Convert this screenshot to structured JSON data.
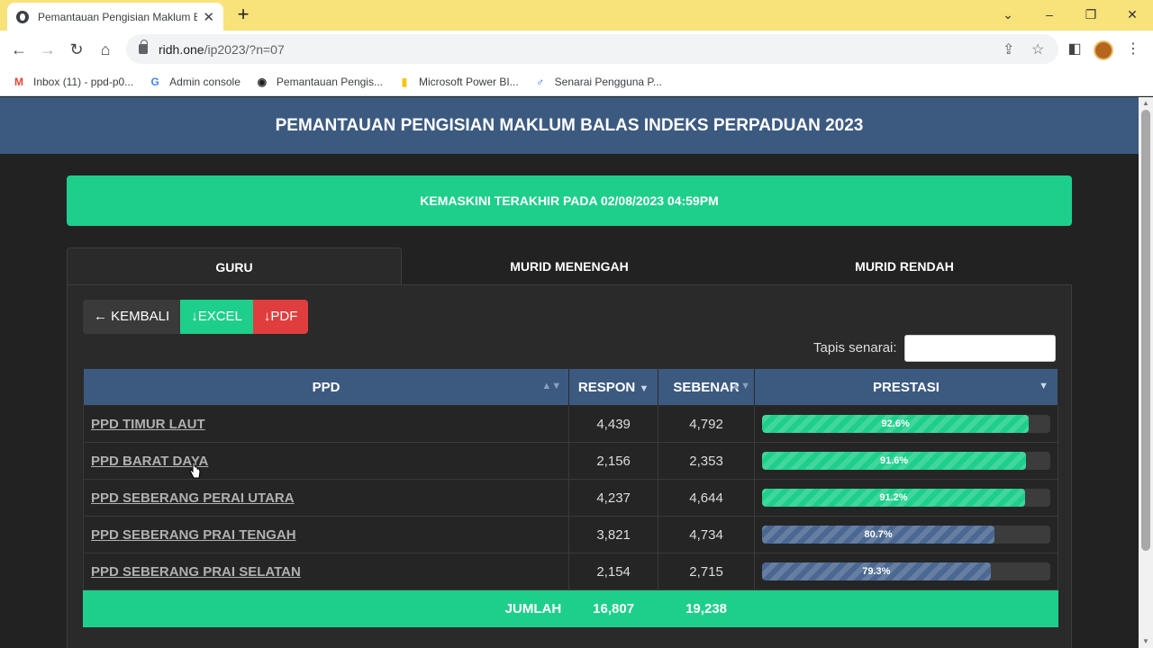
{
  "browser": {
    "tab_title": "Pemantauan Pengisian Maklum B",
    "url_host": "ridh.one",
    "url_path": "/ip2023/?n=07",
    "bookmarks": [
      {
        "icon": "gmail-icon",
        "glyph": "M",
        "color": "#ea4335",
        "label": "Inbox (11) - ppd-p0..."
      },
      {
        "icon": "google-icon",
        "glyph": "G",
        "color": "#4285f4",
        "label": "Admin console"
      },
      {
        "icon": "globe-icon",
        "glyph": "◉",
        "color": "#202124",
        "label": "Pemantauan Pengis..."
      },
      {
        "icon": "powerbi-icon",
        "glyph": "▮",
        "color": "#f2c811",
        "label": "Microsoft Power BI..."
      },
      {
        "icon": "user-list-icon",
        "glyph": "♂",
        "color": "#1a73e8",
        "label": "Senarai Pengguna P..."
      }
    ]
  },
  "page": {
    "title": "PEMANTAUAN PENGISIAN MAKLUM BALAS INDEKS PERPADUAN 2023",
    "updated": "KEMASKINI TERAKHIR PADA 02/08/2023 04:59PM",
    "tabs": [
      "GURU",
      "MURID MENENGAH",
      "MURID RENDAH"
    ],
    "buttons": {
      "back": "← KEMBALI",
      "excel": "↓EXCEL",
      "pdf": "↓PDF"
    },
    "filter_label": "Tapis senarai:",
    "filter_value": ""
  },
  "table": {
    "headers": [
      "PPD",
      "RESPON",
      "SEBENAR",
      "PRESTASI"
    ],
    "rows": [
      {
        "ppd": "PPD TIMUR LAUT",
        "respon": "4,439",
        "sebenar": "4,792",
        "prestasi": "92.6%",
        "pct": 92.6,
        "color": "green"
      },
      {
        "ppd": "PPD BARAT DAYA",
        "respon": "2,156",
        "sebenar": "2,353",
        "prestasi": "91.6%",
        "pct": 91.6,
        "color": "green"
      },
      {
        "ppd": "PPD SEBERANG PERAI UTARA",
        "respon": "4,237",
        "sebenar": "4,644",
        "prestasi": "91.2%",
        "pct": 91.2,
        "color": "green"
      },
      {
        "ppd": "PPD SEBERANG PRAI TENGAH",
        "respon": "3,821",
        "sebenar": "4,734",
        "prestasi": "80.7%",
        "pct": 80.7,
        "color": "blue"
      },
      {
        "ppd": "PPD SEBERANG PRAI SELATAN",
        "respon": "2,154",
        "sebenar": "2,715",
        "prestasi": "79.3%",
        "pct": 79.3,
        "color": "blue"
      }
    ],
    "total": {
      "label": "JUMLAH",
      "respon": "16,807",
      "sebenar": "19,238"
    }
  },
  "colors": {
    "header": "#3c5a80",
    "accent": "#1ecf8b",
    "danger": "#e03e3e",
    "tabstrip": "#f8e27a"
  }
}
